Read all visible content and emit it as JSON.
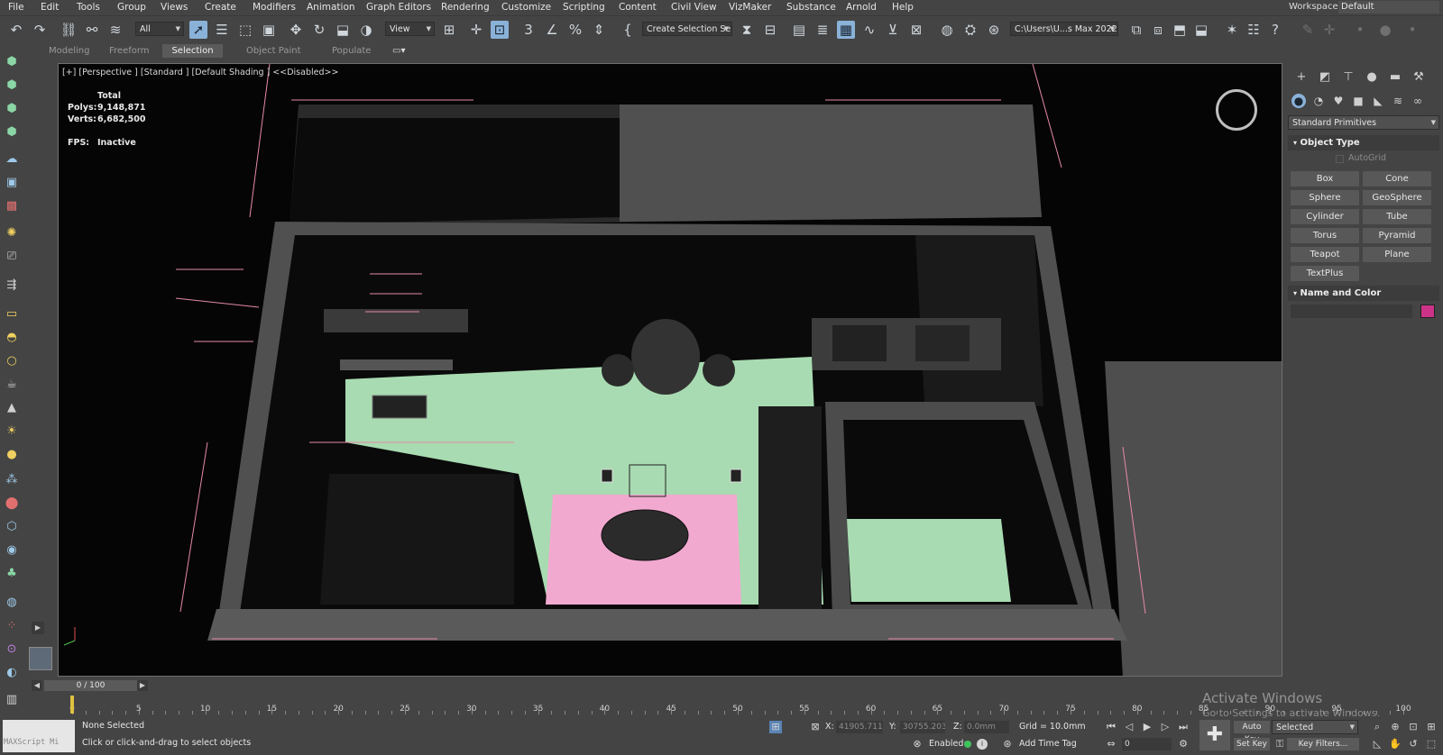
{
  "menu": [
    "File",
    "Edit",
    "Tools",
    "Group",
    "Views",
    "Create",
    "Modifiers",
    "Animation",
    "Graph Editors",
    "Rendering",
    "Customize",
    "Scripting",
    "Content",
    "Civil View",
    "VizMaker",
    "Substance",
    "Arnold",
    "Help"
  ],
  "workspaces": {
    "label": "Workspaces:",
    "value": "Default"
  },
  "toolbar": {
    "filter": "All",
    "ref_coord": "View",
    "selection_set": "Create Selection Se",
    "path": "C:\\Users\\U...s Max 2022",
    "snaps_label": "3",
    "percent_label": "%"
  },
  "ribbon_tabs": [
    "Modeling",
    "Freeform",
    "Selection",
    "Object Paint",
    "Populate"
  ],
  "viewport": {
    "label": "[+] [Perspective ] [Standard ] [Default Shading ]  <<Disabled>>",
    "stats": {
      "header": "Total",
      "polys_label": "Polys:",
      "polys": "9,148,871",
      "verts_label": "Verts:",
      "verts": "6,682,500",
      "fps_label": "FPS:",
      "fps": "Inactive"
    }
  },
  "command_panel": {
    "category": "Standard Primitives",
    "object_type_title": "Object Type",
    "autogrid": "AutoGrid",
    "buttons": [
      "Box",
      "Cone",
      "Sphere",
      "GeoSphere",
      "Cylinder",
      "Tube",
      "Torus",
      "Pyramid",
      "Teapot",
      "Plane",
      "TextPlus"
    ],
    "name_color_title": "Name and Color",
    "color": "#cc3388"
  },
  "timeline": {
    "frame": "0 / 100",
    "ticks": [
      "0",
      "5",
      "10",
      "15",
      "20",
      "25",
      "30",
      "35",
      "40",
      "45",
      "50",
      "55",
      "60",
      "65",
      "70",
      "75",
      "80",
      "85",
      "90",
      "95",
      "100"
    ]
  },
  "status": {
    "maxscript": "MAXScript Mi",
    "selection": "None Selected",
    "prompt": "Click or click-and-drag to select objects",
    "x_label": "X:",
    "x_value": "41905.711",
    "y_label": "Y:",
    "y_value": "30755.203",
    "z_label": "Z:",
    "z_value": "0.0mm",
    "grid": "Grid = 10.0mm",
    "enabled": "Enabled:",
    "add_time_tag": "Add Time Tag",
    "auto_key": "Auto Key",
    "selected": "Selected",
    "set_key": "Set Key",
    "key_filters": "Key Filters...",
    "frame_field": "0"
  },
  "watermark": {
    "line1": "Activate Windows",
    "line2": "Go to Settings to activate Windows."
  },
  "colors": {
    "floor": "#a8dbb1",
    "rug": "#f2a9d0",
    "walls": "#4a4a4a",
    "selection": "#8ab2d8"
  }
}
